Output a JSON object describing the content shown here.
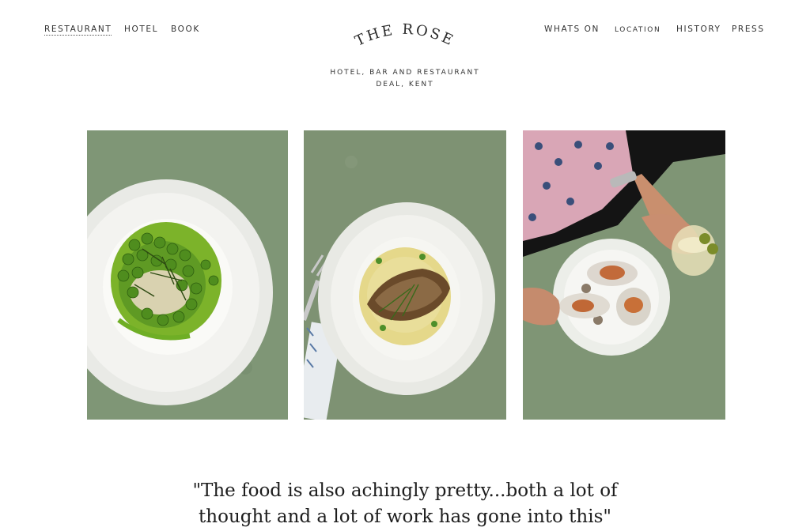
{
  "nav_left": [
    {
      "label": "Restaurant",
      "active": true
    },
    {
      "label": "Hotel",
      "active": false
    },
    {
      "label": "Book",
      "active": false
    }
  ],
  "nav_right": [
    {
      "label": "Whats On"
    },
    {
      "label": "Location"
    },
    {
      "label": "History"
    },
    {
      "label": "Press"
    }
  ],
  "logo": {
    "text": "THE ROSE"
  },
  "tagline": {
    "line1": "Hotel, Bar and Restaurant",
    "line2": "Deal, Kent"
  },
  "gallery": [
    {
      "icon": "pea-dish-photo"
    },
    {
      "icon": "fish-dish-photo"
    },
    {
      "icon": "oyster-dish-photo"
    }
  ],
  "quote": {
    "text": "\"The food is also achingly pretty...both a lot of thought and a lot of work has gone into this\""
  },
  "colors": {
    "table_green": "#7d9474",
    "plate_white": "#f1f1ee",
    "pea_green": "#6aa42c"
  }
}
